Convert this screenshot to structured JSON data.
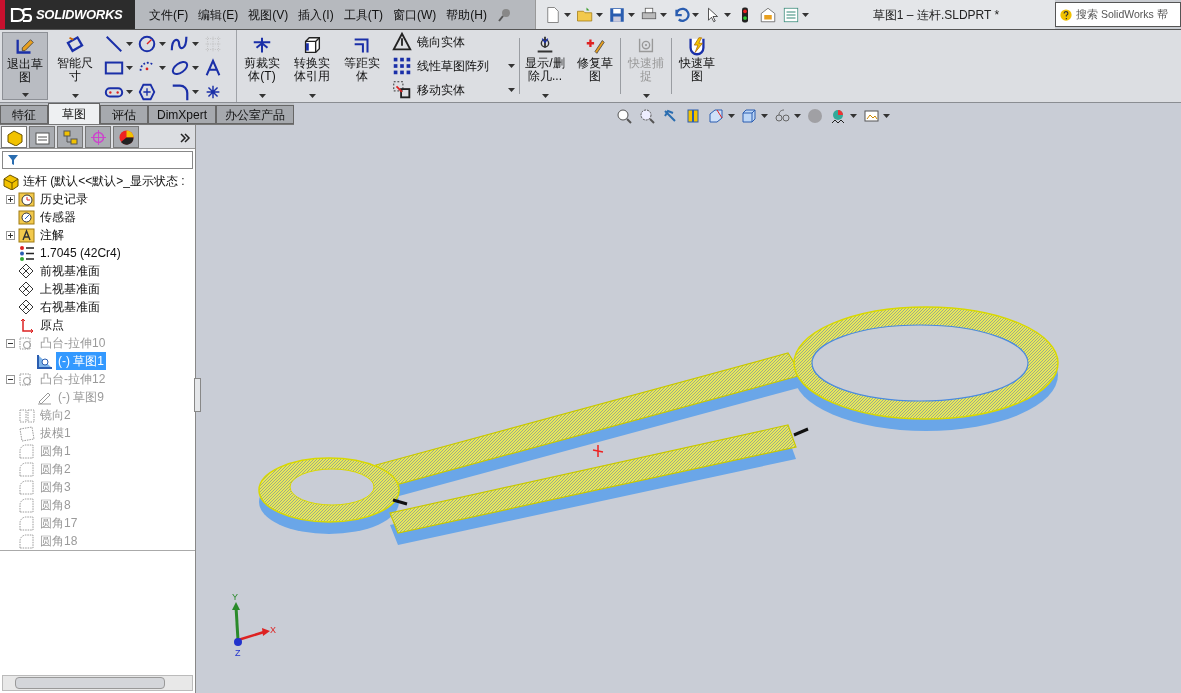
{
  "app": {
    "logo": "SOLIDWORKS"
  },
  "menu": [
    "文件(F)",
    "编辑(E)",
    "视图(V)",
    "插入(I)",
    "工具(T)",
    "窗口(W)",
    "帮助(H)"
  ],
  "document_title": "草图1 – 连杆.SLDPRT *",
  "search": {
    "placeholder": "搜索 SolidWorks 帮"
  },
  "ribbon": [
    {
      "kind": "large",
      "label": "退出草图",
      "pressed": true,
      "dropdown": true,
      "disabled": false
    },
    {
      "kind": "large",
      "label": "智能尺寸",
      "pressed": false,
      "dropdown": true,
      "disabled": false
    },
    {
      "kind": "grid"
    },
    {
      "kind": "large",
      "label": "剪裁实体(T)",
      "pressed": false,
      "dropdown": true,
      "disabled": false
    },
    {
      "kind": "large",
      "label": "转换实体引用",
      "pressed": false,
      "dropdown": true,
      "disabled": false
    },
    {
      "kind": "large",
      "label": "等距实体",
      "pressed": false,
      "dropdown": false,
      "disabled": false
    },
    {
      "kind": "list",
      "items": [
        {
          "label": "镜向实体",
          "dropdown": false
        },
        {
          "label": "线性草图阵列",
          "dropdown": true
        },
        {
          "label": "移动实体",
          "dropdown": true
        }
      ]
    },
    {
      "kind": "separator"
    },
    {
      "kind": "large",
      "label": "显示/删除几...",
      "pressed": false,
      "dropdown": true,
      "disabled": false
    },
    {
      "kind": "large",
      "label": "修复草图",
      "pressed": false,
      "dropdown": false,
      "disabled": false
    },
    {
      "kind": "separator"
    },
    {
      "kind": "large",
      "label": "快速捕捉",
      "pressed": false,
      "dropdown": true,
      "disabled": true
    },
    {
      "kind": "separator"
    },
    {
      "kind": "large",
      "label": "快速草图",
      "pressed": false,
      "dropdown": false,
      "disabled": false
    }
  ],
  "tabs": [
    {
      "label": "特征",
      "selected": false
    },
    {
      "label": "草图",
      "selected": true
    },
    {
      "label": "评估",
      "selected": false
    },
    {
      "label": "DimXpert",
      "selected": false
    },
    {
      "label": "办公室产品",
      "selected": false
    }
  ],
  "panel_tabs": [
    {
      "selected": true
    },
    {
      "selected": false
    },
    {
      "selected": false
    },
    {
      "selected": false
    },
    {
      "selected": false
    }
  ],
  "tree": {
    "label": "连杆 (默认<<默认>_显示状态 :",
    "kind": "part",
    "children": [
      {
        "label": "历史记录",
        "kind": "history",
        "expanded": false,
        "disabled": false,
        "selected": false
      },
      {
        "label": "传感器",
        "kind": "sensor",
        "disabled": false,
        "selected": false
      },
      {
        "label": "注解",
        "kind": "annotation",
        "expanded": false,
        "disabled": false,
        "selected": false
      },
      {
        "label": "1.7045 (42Cr4)",
        "kind": "material",
        "disabled": false,
        "selected": false
      },
      {
        "label": "前视基准面",
        "kind": "plane",
        "disabled": false,
        "selected": false
      },
      {
        "label": "上视基准面",
        "kind": "plane",
        "disabled": false,
        "selected": false
      },
      {
        "label": "右视基准面",
        "kind": "plane",
        "disabled": false,
        "selected": false
      },
      {
        "label": "原点",
        "kind": "origin",
        "disabled": false,
        "selected": false
      },
      {
        "label": "凸台-拉伸10",
        "kind": "extrude",
        "expanded": true,
        "disabled": true,
        "selected": false,
        "children": [
          {
            "label": "(-) 草图1",
            "kind": "sketch",
            "disabled": false,
            "selected": true
          }
        ]
      },
      {
        "label": "凸台-拉伸12",
        "kind": "extrude",
        "expanded": true,
        "disabled": true,
        "selected": false,
        "children": [
          {
            "label": "(-) 草图9",
            "kind": "sketch",
            "disabled": true,
            "selected": false
          }
        ]
      },
      {
        "label": "镜向2",
        "kind": "mirror",
        "disabled": true,
        "selected": false
      },
      {
        "label": "拔模1",
        "kind": "draft",
        "disabled": true,
        "selected": false
      },
      {
        "label": "圆角1",
        "kind": "fillet",
        "disabled": true,
        "selected": false
      },
      {
        "label": "圆角2",
        "kind": "fillet",
        "disabled": true,
        "selected": false
      },
      {
        "label": "圆角3",
        "kind": "fillet",
        "disabled": true,
        "selected": false
      },
      {
        "label": "圆角8",
        "kind": "fillet",
        "disabled": true,
        "selected": false
      },
      {
        "label": "圆角17",
        "kind": "fillet",
        "disabled": true,
        "selected": false
      },
      {
        "label": "圆角18",
        "kind": "fillet",
        "disabled": true,
        "selected": false
      }
    ]
  },
  "triad": {
    "x": "X",
    "y": "Y",
    "z": "Z"
  }
}
